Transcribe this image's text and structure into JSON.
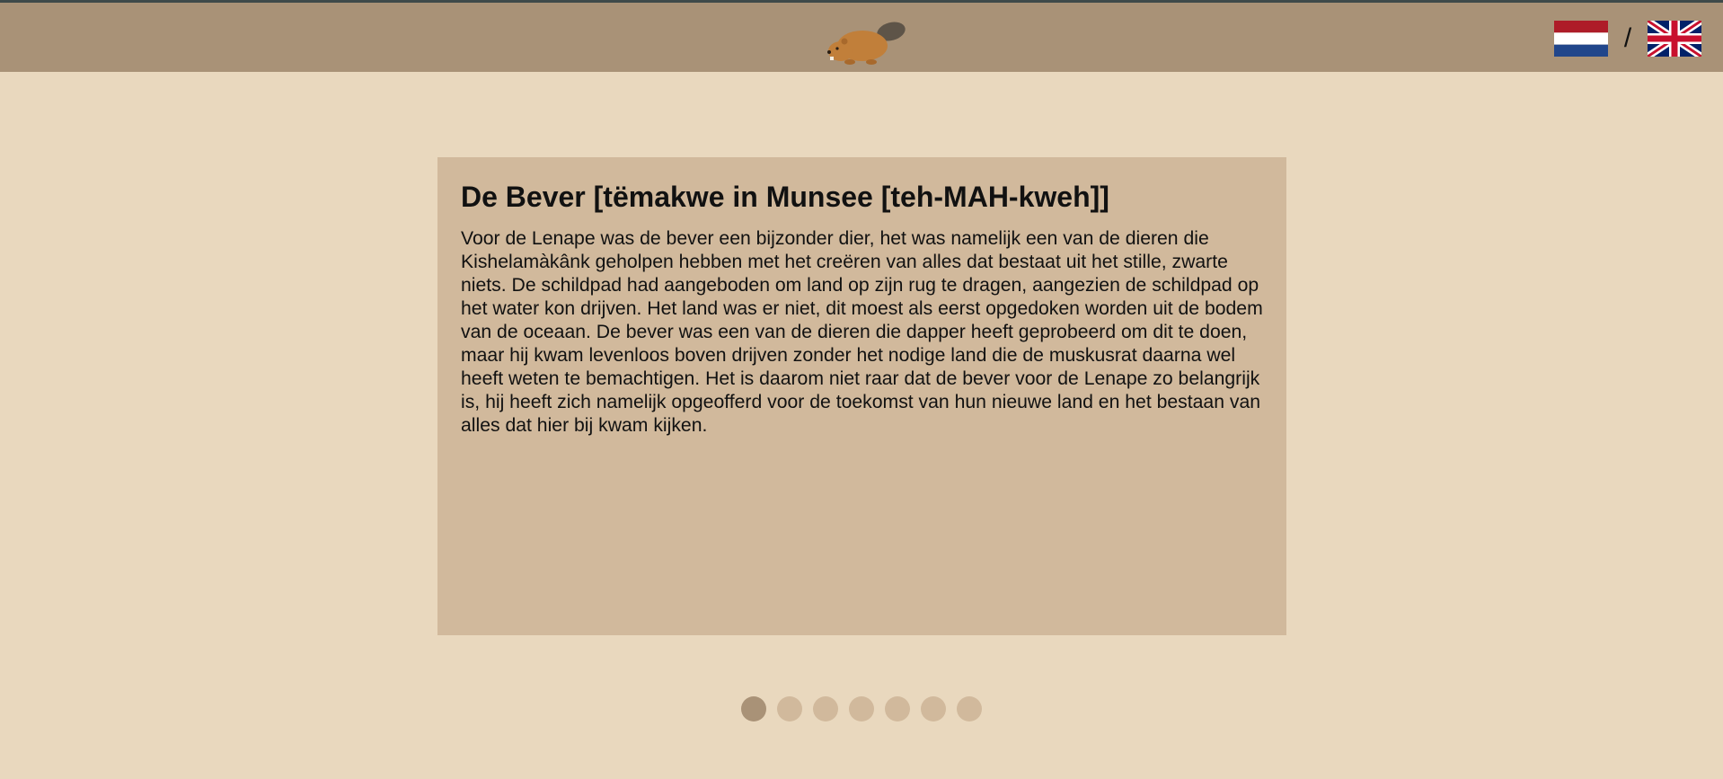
{
  "header": {
    "logo_icon": "beaver-icon",
    "language_separator": "/",
    "languages": [
      {
        "code": "nl",
        "icon": "netherlands-flag-icon"
      },
      {
        "code": "en",
        "icon": "uk-flag-icon"
      }
    ]
  },
  "card": {
    "title": "De Bever [tëmakwe in Munsee [teh-MAH-kweh]]",
    "body": "Voor de Lenape was de bever een bijzonder dier, het was namelijk een van de dieren die Kishelamàkânk geholpen hebben met het creëren van alles dat bestaat uit het stille, zwarte niets. De schildpad had aangeboden om land op zijn rug te dragen, aangezien de schildpad op het water kon drijven. Het land was er niet, dit moest als eerst opgedoken worden uit de bodem van de oceaan. De bever was een van de dieren die dapper heeft geprobeerd om dit te doen, maar hij kwam levenloos boven drijven zonder het nodige land die de muskusrat daarna wel heeft weten te bemachtigen. Het is daarom niet raar dat de bever voor de Lenape zo belangrijk is, hij heeft zich namelijk opgeofferd voor de toekomst van hun nieuwe land en het bestaan van alles dat hier bij kwam kijken."
  },
  "carousel": {
    "total": 7,
    "active_index": 0
  },
  "colors": {
    "header_bg": "#A99277",
    "page_bg": "#E9D8BE",
    "card_bg": "#D1B99C",
    "dot_active": "#A99277",
    "dot_inactive": "#D1B99C",
    "beaver": "#C17F3A"
  }
}
